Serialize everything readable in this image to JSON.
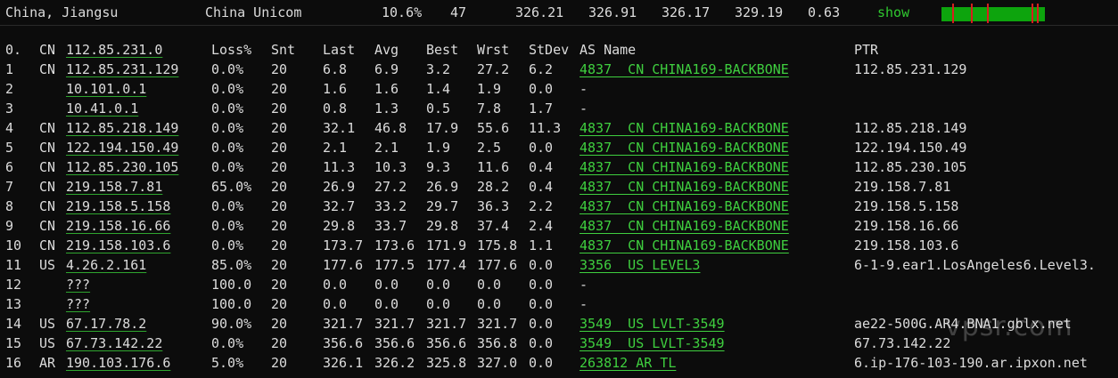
{
  "summary": {
    "location": "China, Jiangsu",
    "isp": "China Unicom",
    "loss": "10.6%",
    "sent": "47",
    "last": "326.21",
    "avg": "326.91",
    "best": "326.17",
    "worst": "329.19",
    "stdev": "0.63",
    "show_label": "show"
  },
  "header": {
    "hop": "0.",
    "cc": "CN",
    "ip": "112.85.231.0",
    "loss": "Loss%",
    "snt": "Snt",
    "last": "Last",
    "avg": "Avg",
    "best": "Best",
    "wrst": "Wrst",
    "stdev": "StDev",
    "as_name": "AS Name",
    "ptr": "PTR"
  },
  "hops": [
    {
      "hop": "1",
      "cc": "CN",
      "ip": "112.85.231.129",
      "loss": "0.0%",
      "snt": "20",
      "last": "6.8",
      "avg": "6.9",
      "best": "3.2",
      "wrst": "27.2",
      "stdev": "6.2",
      "as": "4837  CN CHINA169-BACKBONE",
      "ptr": "112.85.231.129"
    },
    {
      "hop": "2",
      "cc": "",
      "ip": "10.101.0.1",
      "loss": "0.0%",
      "snt": "20",
      "last": "1.6",
      "avg": "1.6",
      "best": "1.4",
      "wrst": "1.9",
      "stdev": "0.0",
      "as": "-",
      "ptr": ""
    },
    {
      "hop": "3",
      "cc": "",
      "ip": "10.41.0.1",
      "loss": "0.0%",
      "snt": "20",
      "last": "0.8",
      "avg": "1.3",
      "best": "0.5",
      "wrst": "7.8",
      "stdev": "1.7",
      "as": "-",
      "ptr": ""
    },
    {
      "hop": "4",
      "cc": "CN",
      "ip": "112.85.218.149",
      "loss": "0.0%",
      "snt": "20",
      "last": "32.1",
      "avg": "46.8",
      "best": "17.9",
      "wrst": "55.6",
      "stdev": "11.3",
      "as": "4837  CN CHINA169-BACKBONE",
      "ptr": "112.85.218.149"
    },
    {
      "hop": "5",
      "cc": "CN",
      "ip": "122.194.150.49",
      "loss": "0.0%",
      "snt": "20",
      "last": "2.1",
      "avg": "2.1",
      "best": "1.9",
      "wrst": "2.5",
      "stdev": "0.0",
      "as": "4837  CN CHINA169-BACKBONE",
      "ptr": "122.194.150.49"
    },
    {
      "hop": "6",
      "cc": "CN",
      "ip": "112.85.230.105",
      "loss": "0.0%",
      "snt": "20",
      "last": "11.3",
      "avg": "10.3",
      "best": "9.3",
      "wrst": "11.6",
      "stdev": "0.4",
      "as": "4837  CN CHINA169-BACKBONE",
      "ptr": "112.85.230.105"
    },
    {
      "hop": "7",
      "cc": "CN",
      "ip": "219.158.7.81",
      "loss": "65.0%",
      "snt": "20",
      "last": "26.9",
      "avg": "27.2",
      "best": "26.9",
      "wrst": "28.2",
      "stdev": "0.4",
      "as": "4837  CN CHINA169-BACKBONE",
      "ptr": "219.158.7.81"
    },
    {
      "hop": "8",
      "cc": "CN",
      "ip": "219.158.5.158",
      "loss": "0.0%",
      "snt": "20",
      "last": "32.7",
      "avg": "33.2",
      "best": "29.7",
      "wrst": "36.3",
      "stdev": "2.2",
      "as": "4837  CN CHINA169-BACKBONE",
      "ptr": "219.158.5.158"
    },
    {
      "hop": "9",
      "cc": "CN",
      "ip": "219.158.16.66",
      "loss": "0.0%",
      "snt": "20",
      "last": "29.8",
      "avg": "33.7",
      "best": "29.8",
      "wrst": "37.4",
      "stdev": "2.4",
      "as": "4837  CN CHINA169-BACKBONE",
      "ptr": "219.158.16.66"
    },
    {
      "hop": "10",
      "cc": "CN",
      "ip": "219.158.103.6",
      "loss": "0.0%",
      "snt": "20",
      "last": "173.7",
      "avg": "173.6",
      "best": "171.9",
      "wrst": "175.8",
      "stdev": "1.1",
      "as": "4837  CN CHINA169-BACKBONE",
      "ptr": "219.158.103.6"
    },
    {
      "hop": "11",
      "cc": "US",
      "ip": "4.26.2.161",
      "loss": "85.0%",
      "snt": "20",
      "last": "177.6",
      "avg": "177.5",
      "best": "177.4",
      "wrst": "177.6",
      "stdev": "0.0",
      "as": "3356  US LEVEL3",
      "ptr": "6-1-9.ear1.LosAngeles6.Level3."
    },
    {
      "hop": "12",
      "cc": "",
      "ip": "???",
      "loss": "100.0",
      "snt": "20",
      "last": "0.0",
      "avg": "0.0",
      "best": "0.0",
      "wrst": "0.0",
      "stdev": "0.0",
      "as": "-",
      "ptr": ""
    },
    {
      "hop": "13",
      "cc": "",
      "ip": "???",
      "loss": "100.0",
      "snt": "20",
      "last": "0.0",
      "avg": "0.0",
      "best": "0.0",
      "wrst": "0.0",
      "stdev": "0.0",
      "as": "-",
      "ptr": ""
    },
    {
      "hop": "14",
      "cc": "US",
      "ip": "67.17.78.2",
      "loss": "90.0%",
      "snt": "20",
      "last": "321.7",
      "avg": "321.7",
      "best": "321.7",
      "wrst": "321.7",
      "stdev": "0.0",
      "as": "3549  US LVLT-3549",
      "ptr": "ae22-500G.AR4.BNA1.gblx.net"
    },
    {
      "hop": "15",
      "cc": "US",
      "ip": "67.73.142.22",
      "loss": "0.0%",
      "snt": "20",
      "last": "356.6",
      "avg": "356.6",
      "best": "356.6",
      "wrst": "356.8",
      "stdev": "0.0",
      "as": "3549  US LVLT-3549",
      "ptr": "67.73.142.22"
    },
    {
      "hop": "16",
      "cc": "AR",
      "ip": "190.103.176.6",
      "loss": "5.0%",
      "snt": "20",
      "last": "326.1",
      "avg": "326.2",
      "best": "325.8",
      "wrst": "327.0",
      "stdev": "0.0",
      "as": "263812 AR TL",
      "ptr": "6.ip-176-103-190.ar.ipxon.net"
    }
  ],
  "watermark": "vpsr.com",
  "colors": {
    "background": "#0c0c0c",
    "text": "#dcdcdc",
    "link_green": "#2fc82f",
    "spark_green": "#0da40d",
    "spark_red": "#d81e1e"
  }
}
